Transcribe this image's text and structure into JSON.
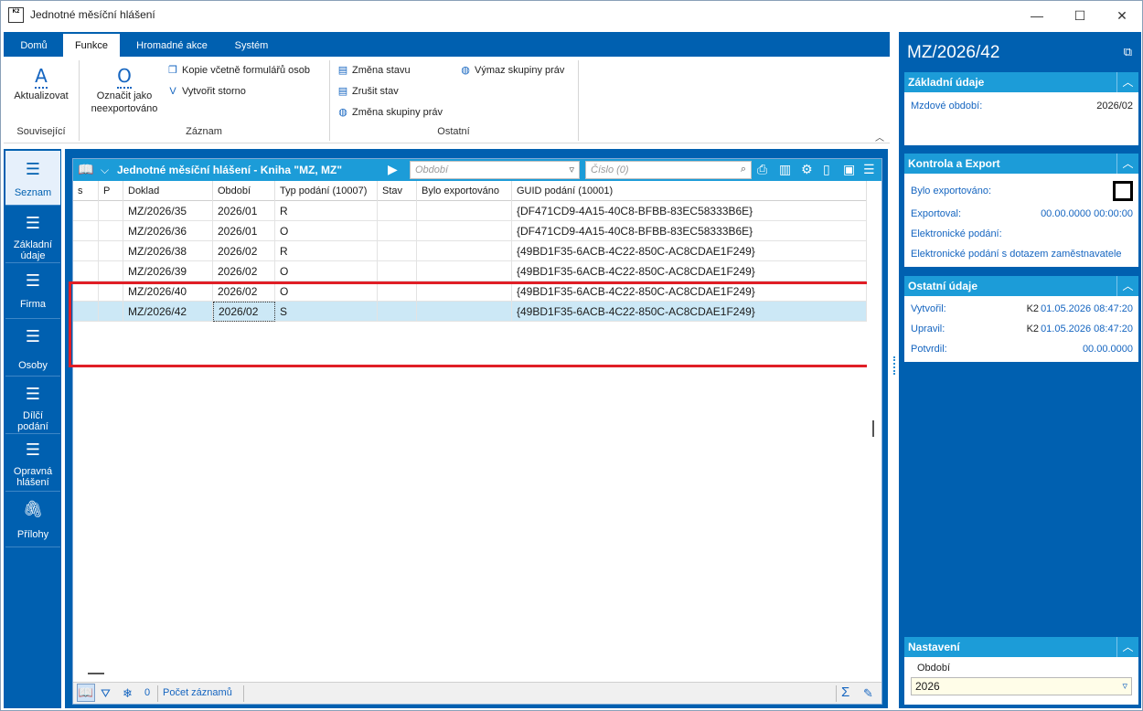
{
  "window": {
    "icon_text": "K2",
    "title": "Jednotné měsíční hlášení",
    "minimize": "—",
    "maximize": "☐",
    "close": "✕"
  },
  "ribbon": {
    "tabs": [
      "Domů",
      "Funkce",
      "Hromadné akce",
      "Systém"
    ],
    "active_tab": "Funkce",
    "groups": {
      "souvisejici": {
        "label": "Související",
        "aktualizovat": "Aktualizovat"
      },
      "zaznam": {
        "label": "Záznam",
        "oznacit": "Označit jako neexportováno",
        "kopie": "Kopie včetně formulářů osob",
        "storno": "Vytvořit storno"
      },
      "ostatni": {
        "label": "Ostatní",
        "zmena_stavu": "Změna stavu",
        "zrusit_stav": "Zrušit stav",
        "zmena_skupiny": "Změna skupiny práv",
        "vymaz_skupiny": "Výmaz skupiny práv"
      }
    }
  },
  "nav": [
    {
      "label": "Seznam",
      "icon": "list-icon"
    },
    {
      "label": "Základní údaje",
      "icon": "list-icon"
    },
    {
      "label": "Firma",
      "icon": "list-icon"
    },
    {
      "label": "Osoby",
      "icon": "list-icon"
    },
    {
      "label": "Dílčí podání",
      "icon": "list-icon"
    },
    {
      "label": "Opravná hlášení",
      "icon": "list-icon"
    },
    {
      "label": "Přílohy",
      "icon": "paperclip-icon"
    }
  ],
  "grid": {
    "title": "Jednotné měsíční hlášení - Kniha \"MZ, MZ\"",
    "obdobi_placeholder": "Období",
    "cislo_placeholder": "Číslo (0)",
    "columns": [
      "s",
      "P",
      "Doklad",
      "Období",
      "Typ podání (10007)",
      "Stav",
      "Bylo exportováno",
      "GUID podání (10001)"
    ],
    "rows": [
      {
        "s": "",
        "p": "",
        "doklad": "MZ/2026/35",
        "obdobi": "2026/01",
        "typ": "R",
        "stav": "",
        "exp": "",
        "guid": "{DF471CD9-4A15-40C8-BFBB-83EC58333B6E}"
      },
      {
        "s": "",
        "p": "",
        "doklad": "MZ/2026/36",
        "obdobi": "2026/01",
        "typ": "O",
        "stav": "",
        "exp": "",
        "guid": "{DF471CD9-4A15-40C8-BFBB-83EC58333B6E}"
      },
      {
        "s": "",
        "p": "",
        "doklad": "MZ/2026/38",
        "obdobi": "2026/02",
        "typ": "R",
        "stav": "",
        "exp": "",
        "guid": "{49BD1F35-6ACB-4C22-850C-AC8CDAE1F249}"
      },
      {
        "s": "",
        "p": "",
        "doklad": "MZ/2026/39",
        "obdobi": "2026/02",
        "typ": "O",
        "stav": "",
        "exp": "",
        "guid": "{49BD1F35-6ACB-4C22-850C-AC8CDAE1F249}"
      },
      {
        "s": "",
        "p": "",
        "doklad": "MZ/2026/40",
        "obdobi": "2026/02",
        "typ": "O",
        "stav": "",
        "exp": "",
        "guid": "{49BD1F35-6ACB-4C22-850C-AC8CDAE1F249}"
      },
      {
        "s": "",
        "p": "",
        "doklad": "MZ/2026/42",
        "obdobi": "2026/02",
        "typ": "S",
        "stav": "",
        "exp": "",
        "guid": "{49BD1F35-6ACB-4C22-850C-AC8CDAE1F249}"
      }
    ],
    "footer": {
      "count": "0",
      "pocet_zaznamu": "Počet záznamů",
      "sum": "Σ"
    }
  },
  "right": {
    "title": "MZ/2026/42",
    "zakladni": {
      "header": "Základní údaje",
      "mzdove_obdobi_label": "Mzdové období:",
      "mzdove_obdobi_value": "2026/02"
    },
    "kontrola": {
      "header": "Kontrola a Export",
      "bylo_exportovano": "Bylo exportováno:",
      "exportoval_label": "Exportoval:",
      "exportoval_value": "00.00.0000 00:00:00",
      "el_podani": "Elektronické podání:",
      "el_podani_dotaz": "Elektronické podání s dotazem zaměstnavatele"
    },
    "ostatni": {
      "header": "Ostatní údaje",
      "vytvoril_label": "Vytvořil:",
      "vytvoril_user": "K2",
      "vytvoril_value": "01.05.2026 08:47:20",
      "upravil_label": "Upravil:",
      "upravil_user": "K2",
      "upravil_value": "01.05.2026 08:47:20",
      "potvrdil_label": "Potvrdil:",
      "potvrdil_value": "00.00.0000"
    },
    "nastaveni": {
      "header": "Nastavení",
      "obdobi_label": "Období",
      "obdobi_value": "2026"
    }
  }
}
